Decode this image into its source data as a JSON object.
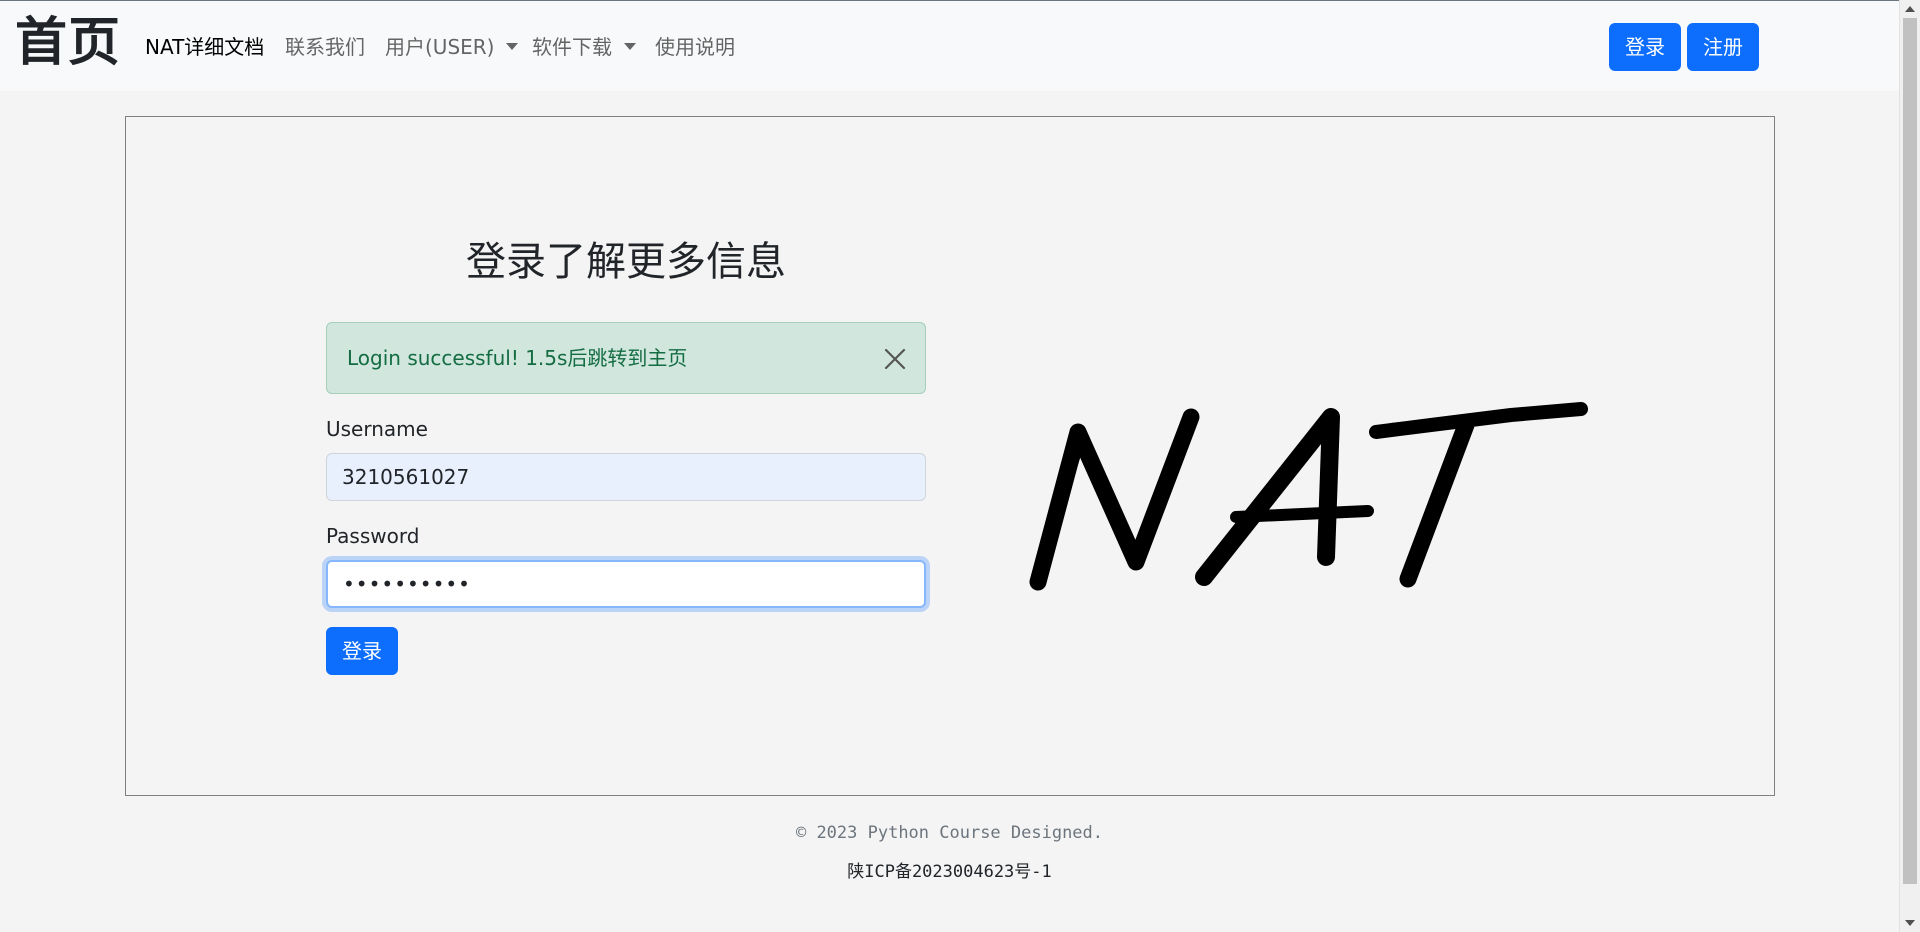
{
  "navbar": {
    "brand": "首页",
    "links": {
      "docs": "NAT详细文档",
      "contact": "联系我们",
      "user": "用户(USER)",
      "download": "软件下载",
      "usage": "使用说明"
    },
    "login_button": "登录",
    "register_button": "注册"
  },
  "main": {
    "heading": "登录了解更多信息",
    "alert": {
      "message": "Login successful! 1.5s后跳转到主页",
      "close_icon": "close-icon"
    },
    "username": {
      "label": "Username",
      "value": "3210561027"
    },
    "password": {
      "label": "Password",
      "value": "••••••••••"
    },
    "submit_button": "登录",
    "logo_text": "NAT"
  },
  "footer": {
    "copyright": "© 2023 Python Course Designed.",
    "icp": "陕ICP备2023004623号-1"
  },
  "colors": {
    "primary": "#0d6efd",
    "alert_bg": "#d1e7dd",
    "alert_text": "#146c43",
    "autofill_bg": "#e8f0fe",
    "focus_border": "#86b7fe"
  }
}
